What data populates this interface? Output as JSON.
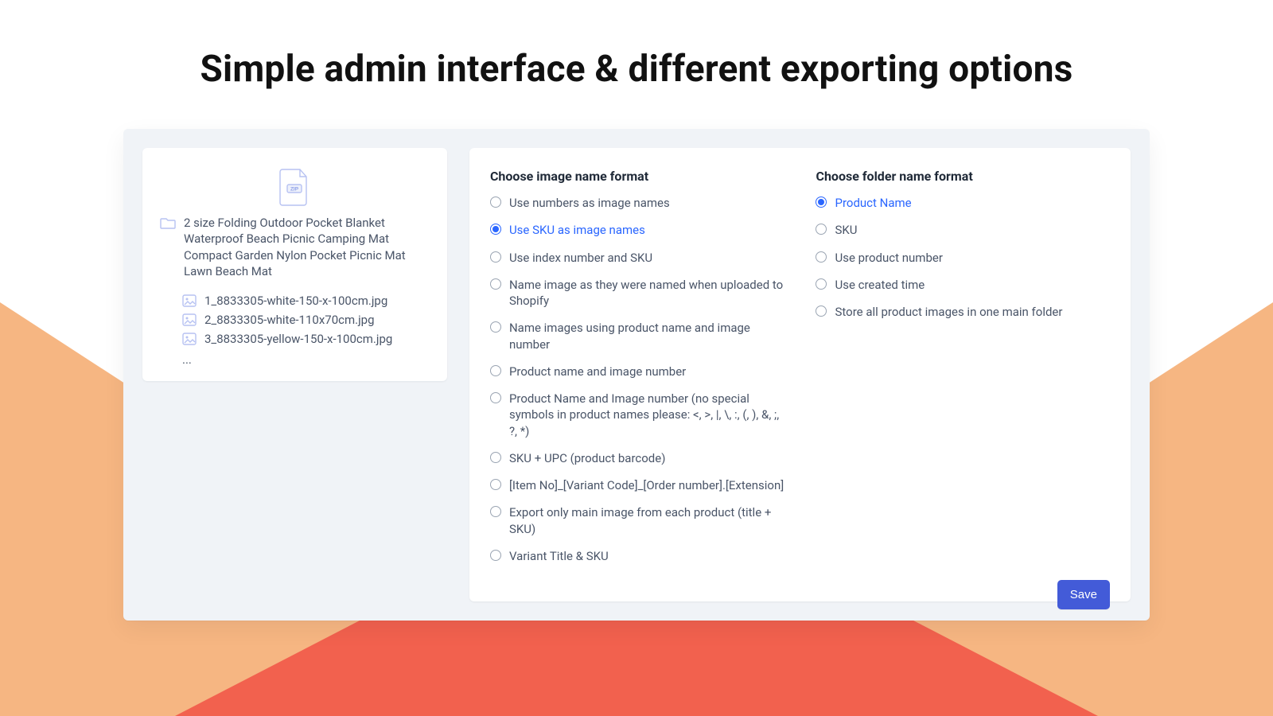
{
  "headline": "Simple admin interface & different exporting options",
  "preview": {
    "folder_name": "2 size Folding Outdoor Pocket Blanket Waterproof Beach Picnic Camping Mat Compact Garden Nylon Pocket Picnic Mat Lawn Beach Mat",
    "files": [
      "1_8833305-white-150-x-100cm.jpg",
      "2_8833305-white-110x70cm.jpg",
      "3_8833305-yellow-150-x-100cm.jpg"
    ],
    "more_indicator": "..."
  },
  "image_name": {
    "title": "Choose image name format",
    "selected_index": 1,
    "options": [
      "Use numbers as image names",
      "Use SKU as image names",
      "Use index number and SKU",
      "Name image as they were named when uploaded to Shopify",
      "Name images using product name and image number",
      "Product name and image number",
      "Product Name and Image number (no special symbols in product names please: <, >, |, \\, :, (, ), &, ;, ?, *)",
      "SKU + UPC (product barcode)",
      "[Item No]_[Variant Code]_[Order number].[Extension]",
      "Export only main image from each product (title + SKU)",
      "Variant Title & SKU"
    ]
  },
  "folder_name": {
    "title": "Choose folder name format",
    "selected_index": 0,
    "options": [
      "Product Name",
      "SKU",
      "Use product number",
      "Use created time",
      "Store all product images in one main folder"
    ]
  },
  "actions": {
    "save_label": "Save"
  },
  "colors": {
    "accent": "#2a66ff",
    "button": "#435bd8",
    "panel_bg": "#f0f3f7"
  }
}
